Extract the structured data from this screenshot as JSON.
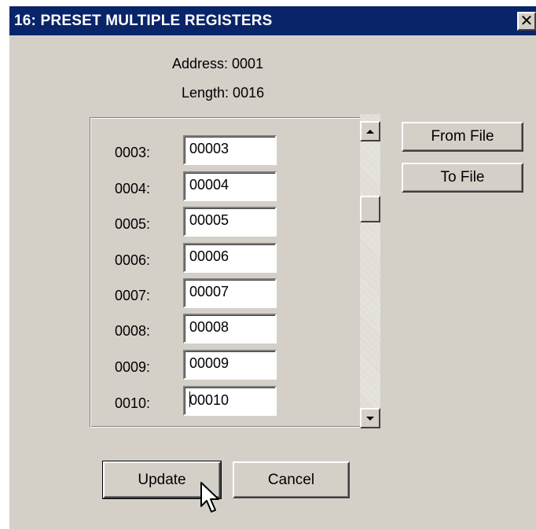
{
  "window": {
    "title": "16: PRESET MULTIPLE REGISTERS",
    "close_symbol": "✕"
  },
  "info": {
    "address": "Address: 0001",
    "length": "Length: 0016"
  },
  "registers": [
    {
      "label": "0003:",
      "value": "00003"
    },
    {
      "label": "0004:",
      "value": "00004"
    },
    {
      "label": "0005:",
      "value": "00005"
    },
    {
      "label": "0006:",
      "value": "00006"
    },
    {
      "label": "0007:",
      "value": "00007"
    },
    {
      "label": "0008:",
      "value": "00008"
    },
    {
      "label": "0009:",
      "value": "00009"
    },
    {
      "label": "0010:",
      "value": "00010"
    }
  ],
  "buttons": {
    "from_file": "From File",
    "to_file": "To File",
    "update": "Update",
    "cancel": "Cancel"
  },
  "colors": {
    "titlebar": "#0a246a",
    "dialog_bg": "#d4d0c8"
  }
}
